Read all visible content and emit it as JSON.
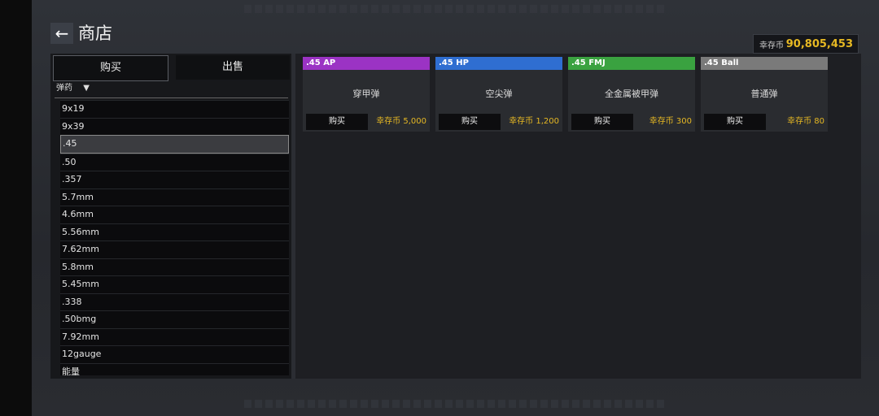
{
  "header": {
    "back_icon": "←",
    "title": "商店"
  },
  "currency": {
    "label": "幸存币",
    "amount": "90,805,453"
  },
  "tabs": {
    "buy": "购买",
    "sell": "出售"
  },
  "filter": {
    "label": "弹药",
    "arrow": "▼"
  },
  "ammo_list": [
    {
      "label": "9x19"
    },
    {
      "label": "9x39"
    },
    {
      "label": ".45",
      "selected": true
    },
    {
      "label": ".50"
    },
    {
      "label": ".357"
    },
    {
      "label": "5.7mm"
    },
    {
      "label": "4.6mm"
    },
    {
      "label": "5.56mm"
    },
    {
      "label": "7.62mm"
    },
    {
      "label": "5.8mm"
    },
    {
      "label": "5.45mm"
    },
    {
      "label": ".338"
    },
    {
      "label": ".50bmg"
    },
    {
      "label": "7.92mm"
    },
    {
      "label": "12gauge"
    },
    {
      "label": "能量"
    }
  ],
  "products": [
    {
      "tag": ".45 AP",
      "name": "穿甲弹",
      "buy_label": "购买",
      "price": "幸存币 5,000",
      "color": "#9b33c4"
    },
    {
      "tag": ".45 HP",
      "name": "空尖弹",
      "buy_label": "购买",
      "price": "幸存币 1,200",
      "color": "#2f6ed1"
    },
    {
      "tag": ".45 FMJ",
      "name": "全金属被甲弹",
      "buy_label": "购买",
      "price": "幸存币 300",
      "color": "#3aa240"
    },
    {
      "tag": ".45 Ball",
      "name": "普通弹",
      "buy_label": "购买",
      "price": "幸存币 80",
      "color": "#7a7a7a"
    }
  ]
}
